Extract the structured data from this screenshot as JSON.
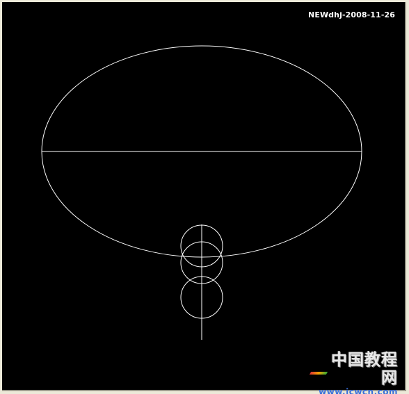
{
  "stamp": {
    "text": "NEWdhj-2008-11-26"
  },
  "watermark": {
    "cn_text": "中国教程网",
    "url_text": "www.jcwcn.com"
  },
  "colors": {
    "canvas_background": "#000000",
    "stroke": "#ffffff",
    "frame": "#ece9d8",
    "watermark_url": "#3a6fd8"
  },
  "drawing": {
    "description_elements": [
      "large-ellipse",
      "ellipse-major-axis",
      "small-ellipse-top",
      "small-ellipse-middle",
      "small-ellipse-bottom",
      "vertical-axis-line"
    ]
  }
}
